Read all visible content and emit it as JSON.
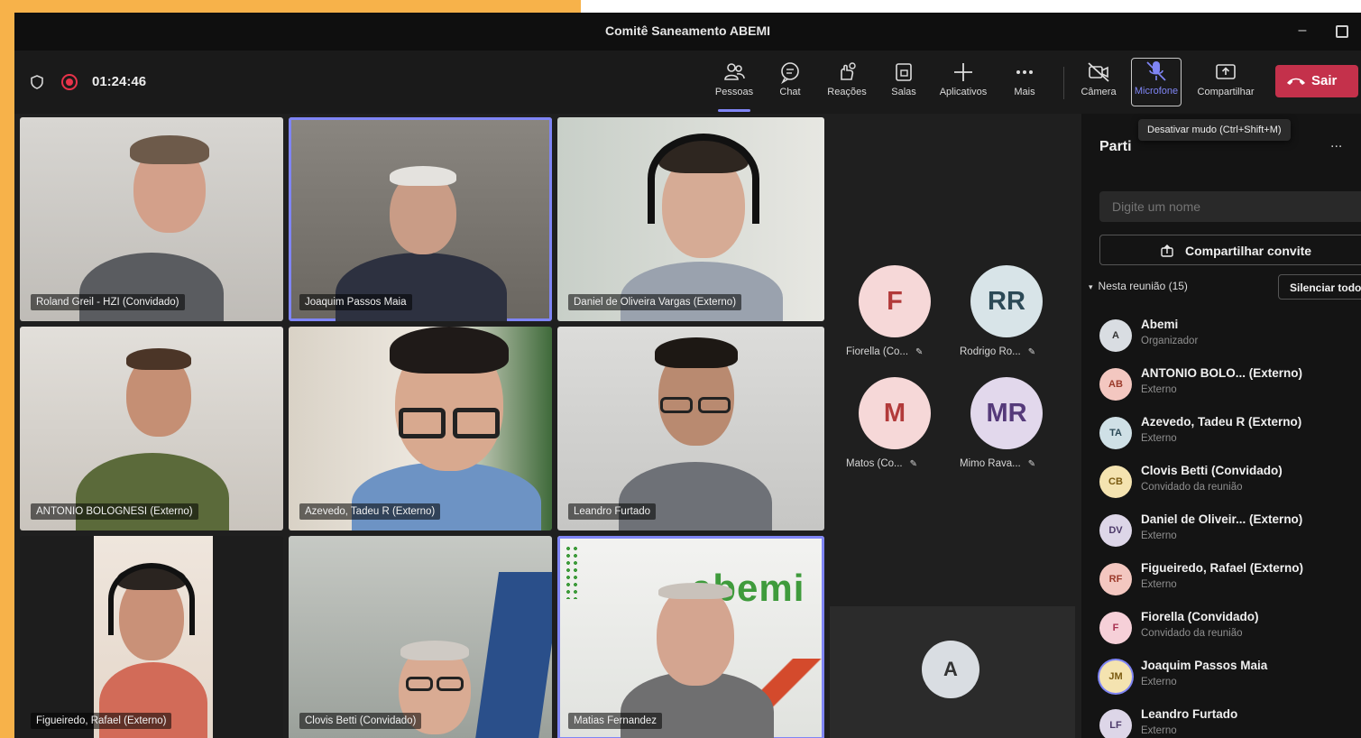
{
  "window": {
    "title": "Comitê Saneamento ABEMI",
    "minimize_glyph": "–"
  },
  "toolbar": {
    "timer": "01:24:46",
    "buttons": [
      {
        "label": "Pessoas",
        "icon": "people-icon"
      },
      {
        "label": "Chat",
        "icon": "chat-icon"
      },
      {
        "label": "Reações",
        "icon": "reactions-icon"
      },
      {
        "label": "Salas",
        "icon": "rooms-icon"
      },
      {
        "label": "Aplicativos",
        "icon": "plus-icon"
      },
      {
        "label": "Mais",
        "icon": "more-icon"
      },
      {
        "label": "Câmera",
        "icon": "camera-off-icon"
      },
      {
        "label": "Microfone",
        "icon": "mic-off-icon"
      },
      {
        "label": "Compartilhar",
        "icon": "share-icon"
      }
    ],
    "leave_label": "Sair",
    "tooltip": "Desativar mudo (Ctrl+Shift+M)"
  },
  "video_tiles": [
    {
      "name": "Roland Greil - HZI (Convidado)"
    },
    {
      "name": "Joaquim Passos Maia"
    },
    {
      "name": "Daniel de Oliveira Vargas (Externo)"
    },
    {
      "name": "ANTONIO BOLOGNESI (Externo)"
    },
    {
      "name": "Azevedo, Tadeu R (Externo)"
    },
    {
      "name": "Leandro Furtado"
    },
    {
      "name": "Figueiredo, Rafael (Externo)"
    },
    {
      "name": "Clovis Betti (Convidado)"
    },
    {
      "name": "Matias Fernandez",
      "overlay_text": "abemi"
    }
  ],
  "mini_tiles": [
    {
      "initials": "F",
      "label": "Fiorella (Co...",
      "bg": "#f6d8d8",
      "fg": "#b23a3a"
    },
    {
      "initials": "RR",
      "label": "Rodrigo Ro...",
      "bg": "#d8e4e8",
      "fg": "#2c4a57"
    },
    {
      "initials": "M",
      "label": "Matos (Co...",
      "bg": "#f6d8d8",
      "fg": "#b23a3a"
    },
    {
      "initials": "MR",
      "label": "Mimo Rava...",
      "bg": "#e2d8ec",
      "fg": "#553a7a"
    }
  ],
  "self_tile": {
    "initials": "A"
  },
  "panel": {
    "title": "Parti",
    "more": "...",
    "search_placeholder": "Digite um nome",
    "invite_label": "Compartilhar convite",
    "section_label": "Nesta reunião (15)",
    "mute_all_label": "Silenciar todos",
    "participants": [
      {
        "initials": "A",
        "name": "Abemi",
        "role": "Organizador",
        "bg": "#d9dde2",
        "fg": "#333333"
      },
      {
        "initials": "AB",
        "name": "ANTONIO BOLO... (Externo)",
        "role": "Externo",
        "bg": "#f3c7c0",
        "fg": "#9b3a2a"
      },
      {
        "initials": "TA",
        "name": "Azevedo, Tadeu R (Externo)",
        "role": "Externo",
        "bg": "#cfe0e6",
        "fg": "#2c4a57"
      },
      {
        "initials": "CB",
        "name": "Clovis Betti (Convidado)",
        "role": "Convidado da reunião",
        "bg": "#f4e3b0",
        "fg": "#7a5a10"
      },
      {
        "initials": "DV",
        "name": "Daniel de Oliveir... (Externo)",
        "role": "Externo",
        "bg": "#ddd6e8",
        "fg": "#4d3a6a"
      },
      {
        "initials": "RF",
        "name": "Figueiredo, Rafael (Externo)",
        "role": "Externo",
        "bg": "#f3c7c0",
        "fg": "#9b3a2a"
      },
      {
        "initials": "F",
        "name": "Fiorella (Convidado)",
        "role": "Convidado da reunião",
        "bg": "#f6d0d8",
        "fg": "#a83050"
      },
      {
        "initials": "JM",
        "name": "Joaquim Passos Maia",
        "role": "Externo",
        "bg": "#f4e3b0",
        "fg": "#7a5a10"
      },
      {
        "initials": "LF",
        "name": "Leandro Furtado",
        "role": "Externo",
        "bg": "#ddd6e8",
        "fg": "#4d3a6a"
      }
    ]
  },
  "colors": {
    "accent": "#7f85f5",
    "leave": "#c4314b",
    "page_frame": "#f7b24a"
  }
}
